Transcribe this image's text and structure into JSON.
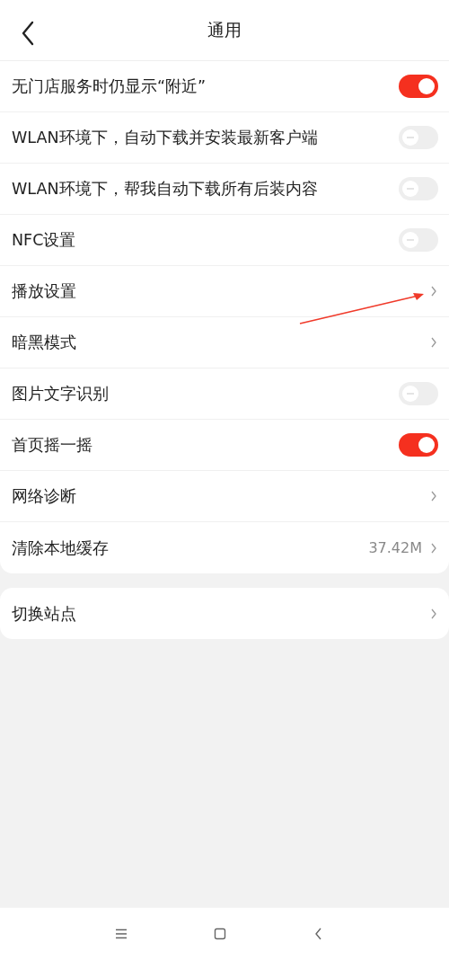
{
  "header": {
    "title": "通用"
  },
  "sections": [
    {
      "rows": [
        {
          "kind": "toggle",
          "label": "无门店服务时仍显示“附近”",
          "on": true
        },
        {
          "kind": "toggle",
          "label": "WLAN环境下，自动下载并安装最新客户端",
          "on": false
        },
        {
          "kind": "toggle",
          "label": "WLAN环境下，帮我自动下载所有后装内容",
          "on": false
        },
        {
          "kind": "toggle",
          "label": "NFC设置",
          "on": false
        },
        {
          "kind": "link",
          "label": "播放设置"
        },
        {
          "kind": "link",
          "label": "暗黑模式"
        },
        {
          "kind": "toggle",
          "label": "图片文字识别",
          "on": false
        },
        {
          "kind": "toggle",
          "label": "首页摇一摇",
          "on": true
        },
        {
          "kind": "link",
          "label": "网络诊断"
        },
        {
          "kind": "link",
          "label": "清除本地缓存",
          "value": "37.42M"
        }
      ]
    },
    {
      "rows": [
        {
          "kind": "link",
          "label": "切换站点"
        }
      ]
    }
  ]
}
